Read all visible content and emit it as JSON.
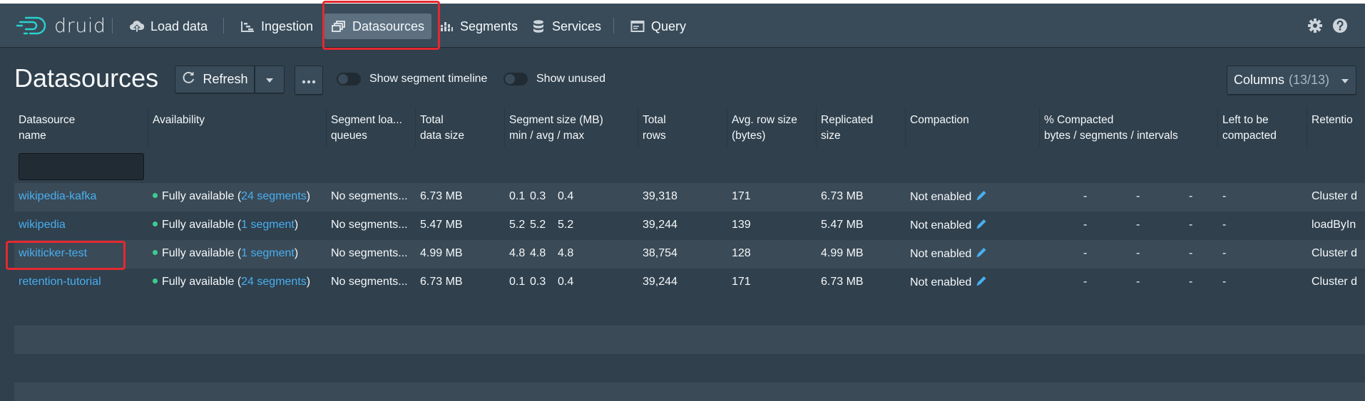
{
  "header": {
    "logo_text": "druid",
    "nav": [
      {
        "label": "Load data",
        "icon": "cloud-upload-icon"
      },
      {
        "label": "Ingestion",
        "icon": "gantt-chart-icon"
      },
      {
        "label": "Datasources",
        "icon": "multi-select-icon",
        "active": true
      },
      {
        "label": "Segments",
        "icon": "stacked-chart-icon"
      },
      {
        "label": "Services",
        "icon": "database-icon"
      },
      {
        "label": "Query",
        "icon": "application-icon"
      }
    ]
  },
  "page": {
    "title": "Datasources",
    "refresh_label": "Refresh",
    "show_segment_timeline": "Show segment timeline",
    "show_unused": "Show unused",
    "columns_label": "Columns",
    "columns_count": "(13/13)"
  },
  "table": {
    "headers": [
      "Datasource\nname",
      "Availability",
      "Segment loa...\nqueues",
      "Total\ndata size",
      "Segment size (MB)\nmin / avg / max",
      "Total\nrows",
      "Avg. row size\n(bytes)",
      "Replicated\nsize",
      "Compaction",
      "% Compacted\nbytes / segments / intervals",
      "Left to be\ncompacted",
      "Retentio"
    ],
    "rows": [
      {
        "name": "wikipedia-kafka",
        "avail_pre": "Fully available (",
        "avail_link": "24 segments",
        "avail_post": ")",
        "queues": "No segments...",
        "size": "6.73 MB",
        "smin": "0.1",
        "savg": "0.3",
        "smax": "0.4",
        "rows": "39,318",
        "avg": "171",
        "repl": "6.73 MB",
        "compaction": "Not enabled",
        "c1": "-",
        "c2": "-",
        "c3": "-",
        "left": "-",
        "retention": "Cluster d"
      },
      {
        "name": "wikipedia",
        "avail_pre": "Fully available (",
        "avail_link": "1 segment",
        "avail_post": ")",
        "queues": "No segments...",
        "size": "5.47 MB",
        "smin": "5.2",
        "savg": "5.2",
        "smax": "5.2",
        "rows": "39,244",
        "avg": "139",
        "repl": "5.47 MB",
        "compaction": "Not enabled",
        "c1": "-",
        "c2": "-",
        "c3": "-",
        "left": "-",
        "retention": "loadByIn"
      },
      {
        "name": "wikiticker-test",
        "avail_pre": "Fully available (",
        "avail_link": "1 segment",
        "avail_post": ")",
        "queues": "No segments...",
        "size": "4.99 MB",
        "smin": "4.8",
        "savg": "4.8",
        "smax": "4.8",
        "rows": "38,754",
        "avg": "128",
        "repl": "4.99 MB",
        "compaction": "Not enabled",
        "c1": "-",
        "c2": "-",
        "c3": "-",
        "left": "-",
        "retention": "Cluster d"
      },
      {
        "name": "retention-tutorial",
        "avail_pre": "Fully available (",
        "avail_link": "24 segments",
        "avail_post": ")",
        "queues": "No segments...",
        "size": "6.73 MB",
        "smin": "0.1",
        "savg": "0.3",
        "smax": "0.4",
        "rows": "39,244",
        "avg": "171",
        "repl": "6.73 MB",
        "compaction": "Not enabled",
        "c1": "-",
        "c2": "-",
        "c3": "-",
        "left": "-",
        "retention": "Cluster d"
      }
    ]
  },
  "colors": {
    "background": "#30404d",
    "header": "#394b59",
    "link": "#48aff0",
    "available_dot": "#3dcc91",
    "highlight": "#e5292f"
  }
}
